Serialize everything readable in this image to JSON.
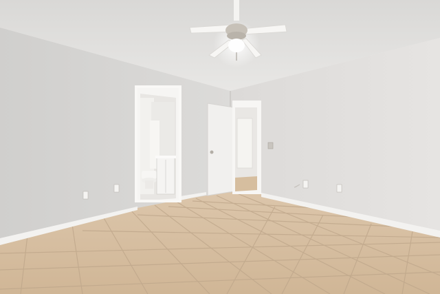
{
  "scene": {
    "colors": {
      "ceiling": "#e4e3e1",
      "ceiling_shadow": "#cfcdca",
      "wall_left": "#d7d6d4",
      "wall_back": "#dedcda",
      "wall_right": "#e2e0de",
      "baseboard": "#f4f3f1",
      "floor_tile": "#d8c0a4",
      "floor_grout": "#b9a186",
      "door": "#f2f1ef",
      "bathroom": "#ecebe8",
      "fan_blade": "#f7f6f4",
      "fan_metal": "#b5b0a8"
    },
    "objects": [
      "ceiling-fan",
      "bathroom-doorway",
      "open-door",
      "hallway-doorway",
      "tiled-floor",
      "electrical-outlets"
    ]
  }
}
